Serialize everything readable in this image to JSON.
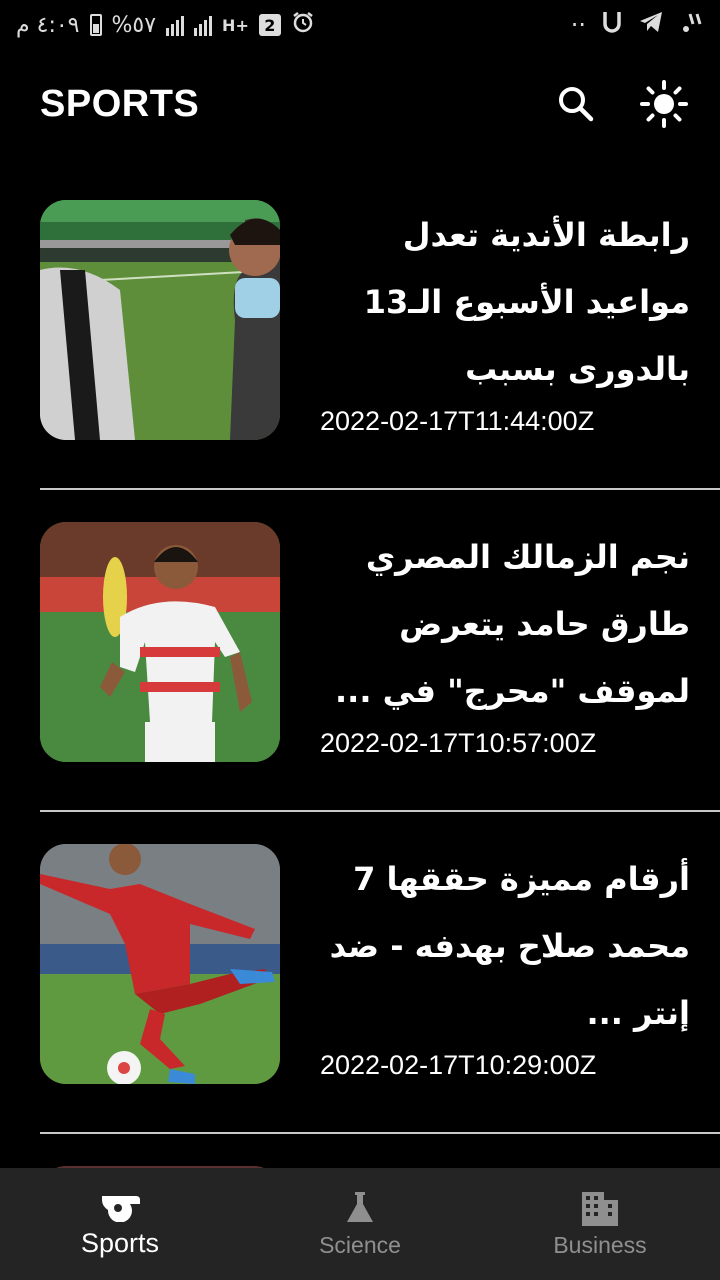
{
  "status_bar": {
    "time": "٤:٠٩ م",
    "battery": "%٥٧",
    "network": "H+",
    "sim_badge": "2",
    "dots": "··"
  },
  "header": {
    "title": "SPORTS",
    "search_icon": "search-icon",
    "theme_icon": "sun-icon"
  },
  "articles": [
    {
      "headline": "رابطة الأندية تعدل مواعيد الأسبوع الـ13 بالدورى بسبب كيروش...",
      "timestamp": "2022-02-17T11:44:00Z"
    },
    {
      "headline": "نجم الزمالك المصري طارق حامد يتعرض لموقف \"محرج\" في ...",
      "timestamp": "2022-02-17T10:57:00Z"
    },
    {
      "headline": "أرقام مميزة حققها 7 محمد صلاح بهدفه - ضد إنتر ...",
      "timestamp": "2022-02-17T10:29:00Z"
    }
  ],
  "bottom_nav": {
    "items": [
      {
        "label": "Sports",
        "icon": "whistle-icon",
        "active": true
      },
      {
        "label": "Science",
        "icon": "flask-icon",
        "active": false
      },
      {
        "label": "Business",
        "icon": "building-icon",
        "active": false
      }
    ]
  }
}
